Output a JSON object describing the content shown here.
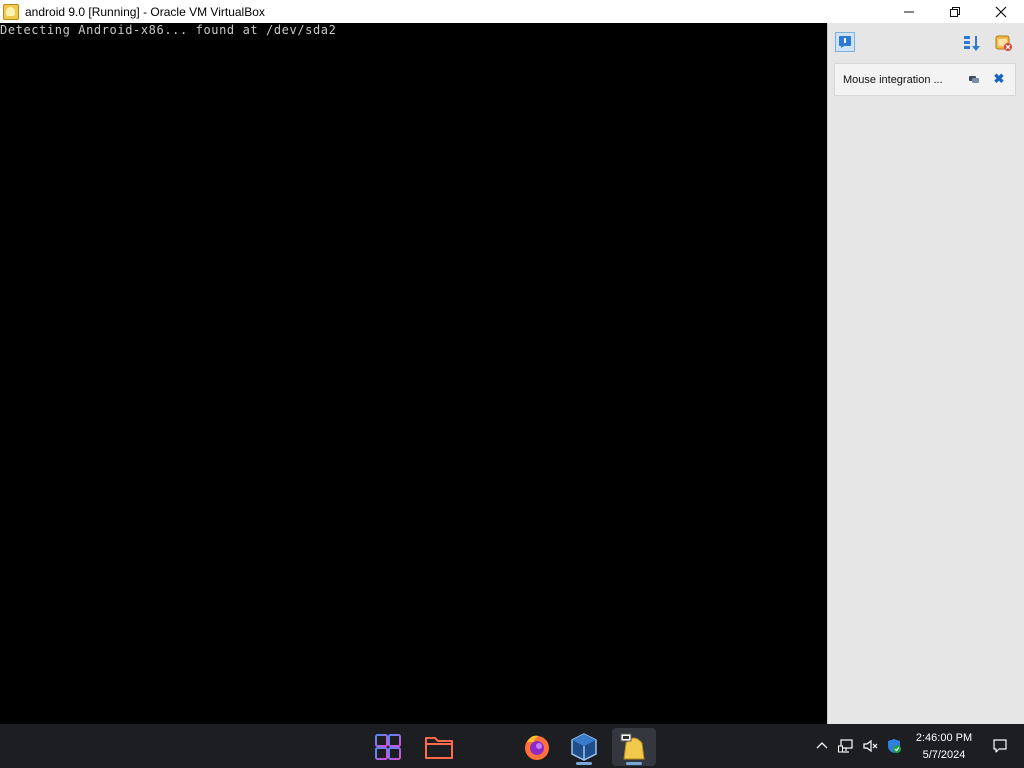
{
  "window": {
    "title": "android 9.0 [Running] - Oracle VM VirtualBox",
    "minimize_label": "—",
    "restore_label": "❐",
    "close_label": "✕"
  },
  "console": {
    "line1": "Detecting Android-x86... found at /dev/sda2"
  },
  "notification_pane": {
    "item_text": "Mouse integration ...",
    "close_label": "✖"
  },
  "taskbar": {
    "apps": [
      "start-button",
      "file-explorer",
      "firefox",
      "virtualbox-manager",
      "virtualbox-vm"
    ],
    "active_app": "virtualbox-vm",
    "time": "2:46:00 PM",
    "date": "5/7/2024"
  },
  "colors": {
    "vm_background": "#000000",
    "console_text": "#c8c8c8",
    "pane_background": "#e6e6e6",
    "taskbar_background": "#1c1e22",
    "accent": "#1565c0"
  }
}
